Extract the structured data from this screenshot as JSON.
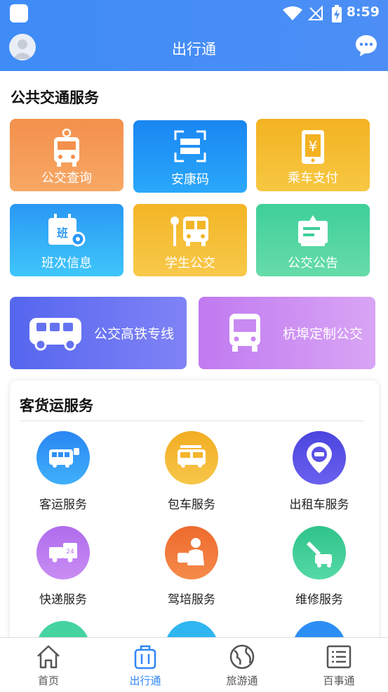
{
  "status": {
    "time": "8:59"
  },
  "header": {
    "title": "出行通"
  },
  "public_transit": {
    "title": "公共交通服务",
    "tiles": [
      {
        "label": "公交查询",
        "colors": [
          "#f18a45",
          "#f6a85f"
        ]
      },
      {
        "label": "安康码",
        "colors": [
          "#1c8bf3",
          "#27a5fb"
        ]
      },
      {
        "label": "乘车支付",
        "colors": [
          "#f3b324",
          "#f6c63c"
        ]
      },
      {
        "label": "班次信息",
        "colors": [
          "#2a9df5",
          "#3cc3fa"
        ]
      },
      {
        "label": "学生公交",
        "colors": [
          "#f3b628",
          "#f8c84a"
        ]
      },
      {
        "label": "公交公告",
        "colors": [
          "#3fcf9c",
          "#62dba8"
        ]
      }
    ],
    "banners": [
      {
        "label": "公交高铁专线",
        "colors": [
          "#5968f0",
          "#7f82f6"
        ]
      },
      {
        "label": "杭埠定制公交",
        "colors": [
          "#c37ef0",
          "#d8a4f5"
        ]
      }
    ]
  },
  "freight": {
    "title": "客货运服务",
    "items": [
      {
        "label": "客运服务",
        "color": "#2e8ef5"
      },
      {
        "label": "包车服务",
        "color": "#f3b52a"
      },
      {
        "label": "出租车服务",
        "color": "#5b52e6"
      },
      {
        "label": "快递服务",
        "color": "#b775ee"
      },
      {
        "label": "驾培服务",
        "color": "#f27a3a"
      },
      {
        "label": "维修服务",
        "color": "#34c98f"
      }
    ]
  },
  "tabbar": {
    "tabs": [
      {
        "label": "首页"
      },
      {
        "label": "出行通"
      },
      {
        "label": "旅游通"
      },
      {
        "label": "百事通"
      }
    ],
    "active_color": "#2f86f6"
  }
}
